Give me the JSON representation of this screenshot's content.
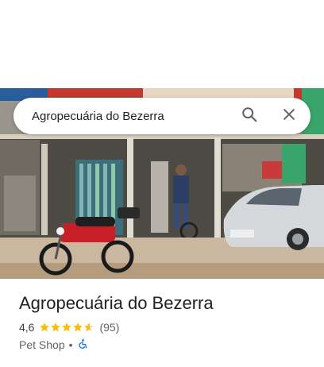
{
  "search": {
    "value": "Agropecuária do Bezerra",
    "search_icon": "search-icon",
    "close_icon": "close-icon"
  },
  "place": {
    "name": "Agropecuária do Bezerra",
    "rating": "4,6",
    "rating_numeric": 4.6,
    "stars_max": 5,
    "reviews": "(95)",
    "category": "Pet Shop",
    "separator": "•",
    "accessibility_icon": "wheelchair-icon"
  },
  "colors": {
    "star": "#fbbc04",
    "star_empty": "#dadce0",
    "accent_blue": "#1a73e8",
    "text_primary": "#202124",
    "text_secondary": "#5f6368"
  }
}
